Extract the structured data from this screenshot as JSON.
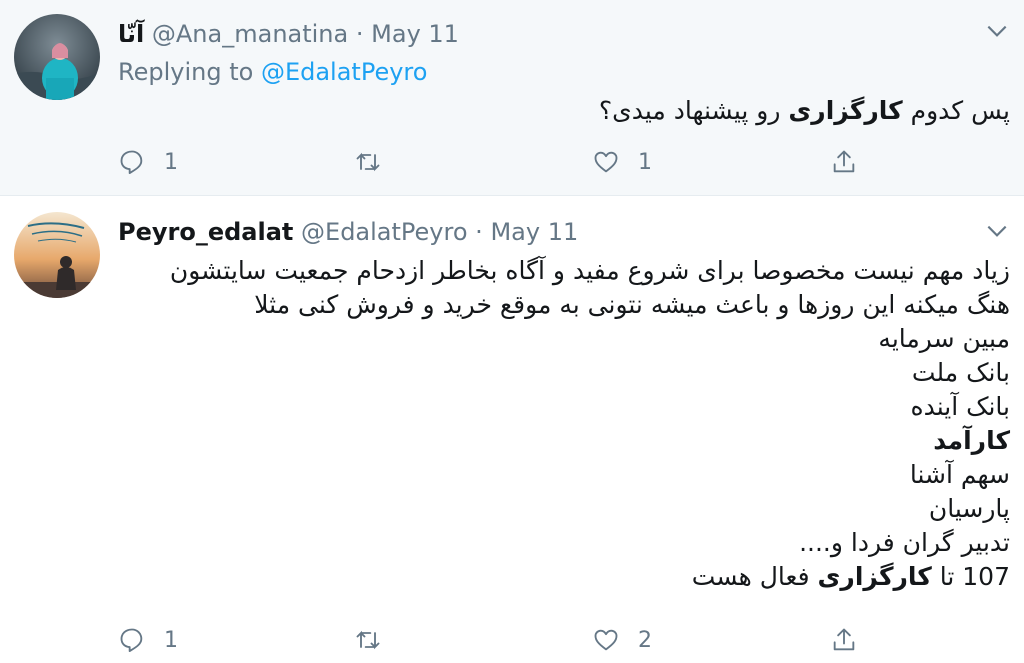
{
  "tweets": [
    {
      "display_name": "آنّا",
      "handle": "@Ana_manatina",
      "dot": "·",
      "date": "May 11",
      "replying_label": "Replying to",
      "replying_to": "@EdalatPeyro",
      "text_plain_1": "پس کدوم ",
      "text_bold": "کارگزاری",
      "text_plain_2": " رو پیشنهاد میدی؟",
      "reply_count": "1",
      "retweet_count": "",
      "like_count": "1"
    },
    {
      "display_name": "Peyro_edalat",
      "handle": "@EdalatPeyro",
      "dot": "·",
      "date": "May 11",
      "lines": [
        "زیاد مهم نیست مخصوصا برای شروع مفید و آگاه بخاطر ازدحام جمعیت سایتشون",
        "هنگ میکنه این روزها و باعث میشه نتونی به موقع خرید و فروش کنی مثلا",
        "مبین سرمایه",
        "بانک ملت",
        "بانک آینده",
        "کارآمد",
        "سهم آشنا",
        "پارسیان",
        "تدبیر گران فردا و...."
      ],
      "last_line_num": "107",
      "last_line_ta": " تا ",
      "last_line_bold": "کارگزاری",
      "last_line_tail": " فعال هست",
      "reply_count": "1",
      "retweet_count": "",
      "like_count": "2"
    }
  ],
  "colors": {
    "accent": "#1da1f2",
    "muted": "#657786",
    "bg_parent": "#f5f8fa"
  },
  "icons": [
    "reply-icon",
    "retweet-icon",
    "like-icon",
    "share-icon",
    "chevron-down-icon"
  ]
}
